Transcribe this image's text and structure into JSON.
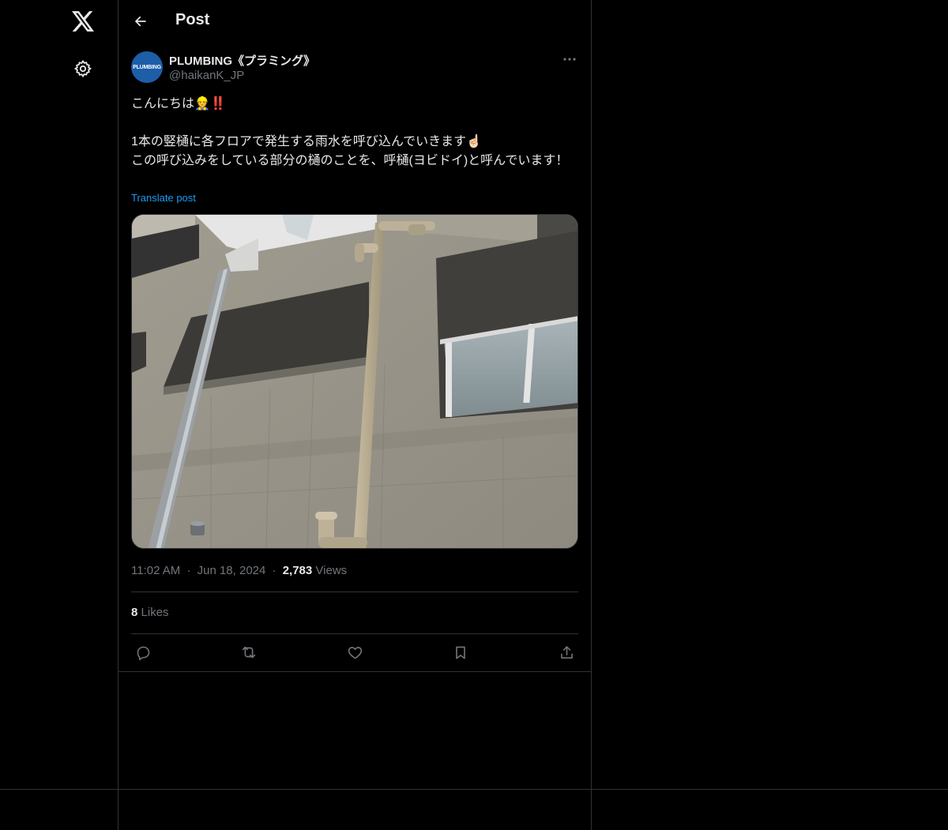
{
  "header": {
    "title": "Post"
  },
  "author": {
    "name": "PLUMBING《プラミング》",
    "handle": "@haikanK_JP",
    "avatar_text": "PLUMBING"
  },
  "post": {
    "line1": "こんにちは",
    "line1_emoji": "👷",
    "line1_mark": "‼️",
    "line2": "1本の竪樋に各フロアで発生する雨水を呼び込んでいきます",
    "line2_emoji": "☝🏻",
    "line3": "この呼び込みをしている部分の樋のことを、呼樋(ヨビドイ)と呼んでいます！",
    "translate_label": "Translate post"
  },
  "meta": {
    "time": "11:02 AM",
    "date": "Jun 18, 2024",
    "views_count": "2,783",
    "views_label": "Views",
    "sep": "·"
  },
  "likes": {
    "count": "8",
    "label": "Likes"
  },
  "icons": {
    "logo": "x-logo-icon",
    "settings": "gear-icon",
    "back": "arrow-left-icon",
    "more": "more-horizontal-icon",
    "reply": "reply-icon",
    "repost": "repost-icon",
    "like": "heart-icon",
    "bookmark": "bookmark-icon",
    "share": "share-icon"
  },
  "colors": {
    "background": "#000000",
    "text": "#e7e9ea",
    "muted": "#71767b",
    "accent": "#1d9bf0",
    "border": "#2f3336"
  }
}
